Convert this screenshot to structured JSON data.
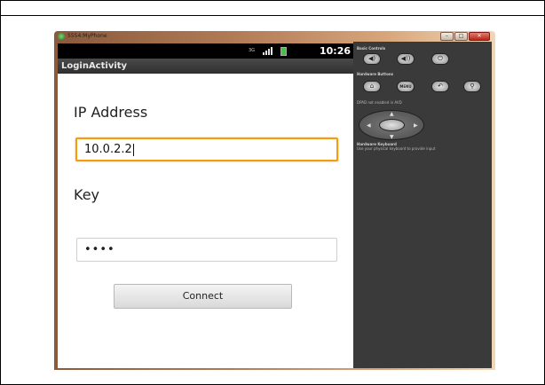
{
  "window": {
    "title": "5554:MyPhone",
    "controls": {
      "minimize": "–",
      "maximize": "□",
      "close": "✕"
    }
  },
  "status_bar": {
    "network": "3G",
    "time": "10:26",
    "icons": [
      "signal-icon",
      "battery-icon"
    ]
  },
  "app_bar": {
    "title": "LoginActivity"
  },
  "form": {
    "ip_label": "IP Address",
    "ip_value": "10.0.2.2",
    "key_label": "Key",
    "key_value": "••••",
    "connect_label": "Connect"
  },
  "controls_panel": {
    "basic_controls_label": "Basic Controls",
    "hardware_buttons_label": "Hardware Buttons",
    "menu_label": "MENU",
    "dpad_label": "DPAD not enabled in AVD",
    "keyboard_label": "Hardware Keyboard",
    "keyboard_hint": "Use your physical keyboard to provide input"
  },
  "colors": {
    "focus_border": "#f39c12",
    "panel_bg": "#3a3a3a",
    "status_bar_bg": "#000000"
  }
}
